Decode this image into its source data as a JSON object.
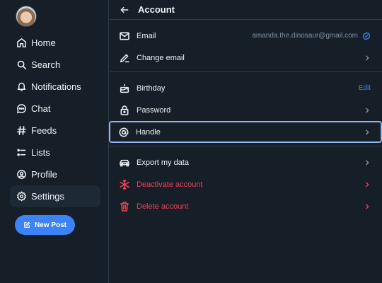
{
  "sidebar": {
    "items": [
      {
        "label": "Home",
        "icon": "home-icon"
      },
      {
        "label": "Search",
        "icon": "search-icon"
      },
      {
        "label": "Notifications",
        "icon": "bell-icon"
      },
      {
        "label": "Chat",
        "icon": "chat-icon"
      },
      {
        "label": "Feeds",
        "icon": "hash-icon"
      },
      {
        "label": "Lists",
        "icon": "list-icon"
      },
      {
        "label": "Profile",
        "icon": "user-circle-icon"
      },
      {
        "label": "Settings",
        "icon": "gear-icon",
        "active": true
      }
    ],
    "new_post_label": "New Post"
  },
  "header": {
    "title": "Account"
  },
  "account": {
    "email_label": "Email",
    "email_value": "amanda.the.dinosaur@gmail.com",
    "change_email_label": "Change email",
    "birthday_label": "Birthday",
    "birthday_action": "Edit",
    "password_label": "Password",
    "handle_label": "Handle",
    "export_label": "Export my data",
    "deactivate_label": "Deactivate account",
    "delete_label": "Delete account"
  },
  "colors": {
    "background": "#161e27",
    "accent": "#3b83f6",
    "danger": "#ee4356",
    "muted": "#7f91a4"
  }
}
